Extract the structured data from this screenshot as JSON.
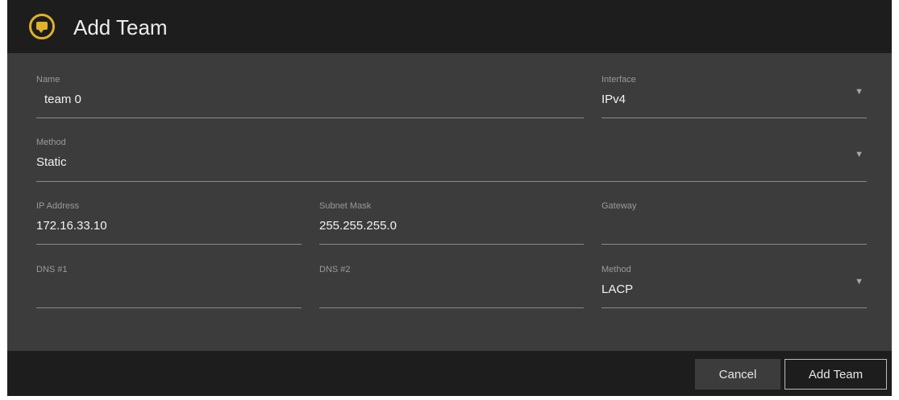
{
  "dialog": {
    "title": "Add Team",
    "icon": "chat-bubble-icon",
    "accent_color": "#e0b12a"
  },
  "form": {
    "name": {
      "label": "Name",
      "value": "team 0"
    },
    "interface": {
      "label": "Interface",
      "value": "IPv4"
    },
    "method": {
      "label": "Method",
      "value": "Static"
    },
    "ip_address": {
      "label": "IP Address",
      "value": "172.16.33.10"
    },
    "subnet_mask": {
      "label": "Subnet Mask",
      "value": "255.255.255.0"
    },
    "gateway": {
      "label": "Gateway",
      "value": ""
    },
    "dns1": {
      "label": "DNS #1",
      "value": ""
    },
    "dns2": {
      "label": "DNS #2",
      "value": ""
    },
    "team_method": {
      "label": "Method",
      "value": "LACP"
    }
  },
  "footer": {
    "cancel_label": "Cancel",
    "add_label": "Add Team"
  }
}
